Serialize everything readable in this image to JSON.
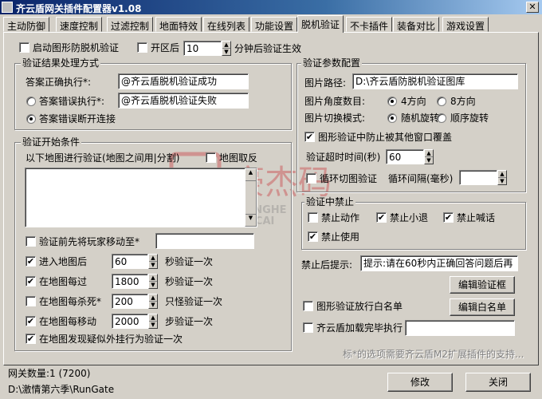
{
  "window": {
    "title": "齐云盾网关插件配置器v1.08",
    "close_glyph": "✕"
  },
  "tabs": [
    "主动防御",
    "速度控制",
    "过滤控制",
    "地面特效",
    "在线列表",
    "功能设置",
    "脱机验证",
    "不卡插件",
    "装备对比",
    "游戏设置"
  ],
  "active_tab": "脱机验证",
  "top": {
    "enable_label": "启动图形防脱机验证",
    "enable_checked": false,
    "open_label": "开区后",
    "open_checked": false,
    "open_value": "10",
    "open_suffix": "分钟后验证生效"
  },
  "result_group": {
    "title": "验证结果处理方式",
    "correct_label": "答案正确执行*:",
    "correct_value": "@齐云盾脱机验证成功",
    "wrong_label": "答案错误执行*:",
    "wrong_value": "@齐云盾脱机验证失败",
    "wrong_selected": false,
    "disconnect_label": "答案错误断开连接",
    "disconnect_selected": true
  },
  "start_group": {
    "title": "验证开始条件",
    "maps_label": "以下地图进行验证(地图之间用|分割)",
    "invert_label": "地图取反",
    "invert_checked": false,
    "move_first_label": "验证前先将玩家移动至*",
    "move_first_checked": false,
    "move_first_value": "",
    "rows": [
      {
        "label": "进入地图后",
        "checked": true,
        "value": "60",
        "suffix": "秒验证一次"
      },
      {
        "label": "在地图每过",
        "checked": true,
        "value": "1800",
        "suffix": "秒验证一次"
      },
      {
        "label": "在地图每杀死*",
        "checked": false,
        "value": "200",
        "suffix": "只怪验证一次"
      },
      {
        "label": "在地图每移动",
        "checked": true,
        "value": "2000",
        "suffix": "步验证一次"
      }
    ],
    "suspect_label": "在地图发现疑似外挂行为验证一次",
    "suspect_checked": true
  },
  "params_group": {
    "title": "验证参数配置",
    "path_label": "图片路径:",
    "path_value": "D:\\齐云盾防脱机验证图库",
    "angle_label": "图片角度数目:",
    "angle_opt1": "4方向",
    "angle_opt2": "8方向",
    "angle_selected": "4方向",
    "switch_label": "图片切换模式:",
    "switch_opt1": "随机旋转",
    "switch_opt2": "顺序旋转",
    "switch_selected": "随机旋转",
    "prevent_label": "图形验证中防止被其他窗口覆盖",
    "prevent_checked": true,
    "timeout_label": "验证超时时间(秒)",
    "timeout_value": "60",
    "loop_label": "循环切图验证",
    "loop_checked": false,
    "loop_interval_label": "循环间隔(毫秒)",
    "loop_interval_value": ""
  },
  "forbid_group": {
    "title": "验证中禁止",
    "items": [
      {
        "label": "禁止动作",
        "checked": false
      },
      {
        "label": "禁止小退",
        "checked": true
      },
      {
        "label": "禁止喊话",
        "checked": true
      },
      {
        "label": "禁止使用",
        "checked": true
      }
    ]
  },
  "after": {
    "hint_label": "禁止后提示:",
    "hint_value": "提示:请在60秒内正确回答问题后再",
    "edit_verify_btn": "编辑验证框",
    "whitelist_label": "图形验证放行白名单",
    "whitelist_checked": false,
    "edit_whitelist_btn": "编辑白名单",
    "after_load_label": "齐云盾加载完毕执行",
    "after_load_checked": false,
    "after_load_value": ""
  },
  "note": "标*的选项需要齐云盾M2扩展插件的支持...",
  "status": {
    "gateway_count": "网关数量:1 (7200)",
    "path": "D:\\激情第六季\\RunGate"
  },
  "buttons": {
    "modify": "修改",
    "close": "关闭"
  },
  "watermark": {
    "text1": "盛",
    "text2": "豪杰码",
    "text3": "SENGHE",
    "text4": "SUCAI",
    "color": "#c8242a"
  }
}
